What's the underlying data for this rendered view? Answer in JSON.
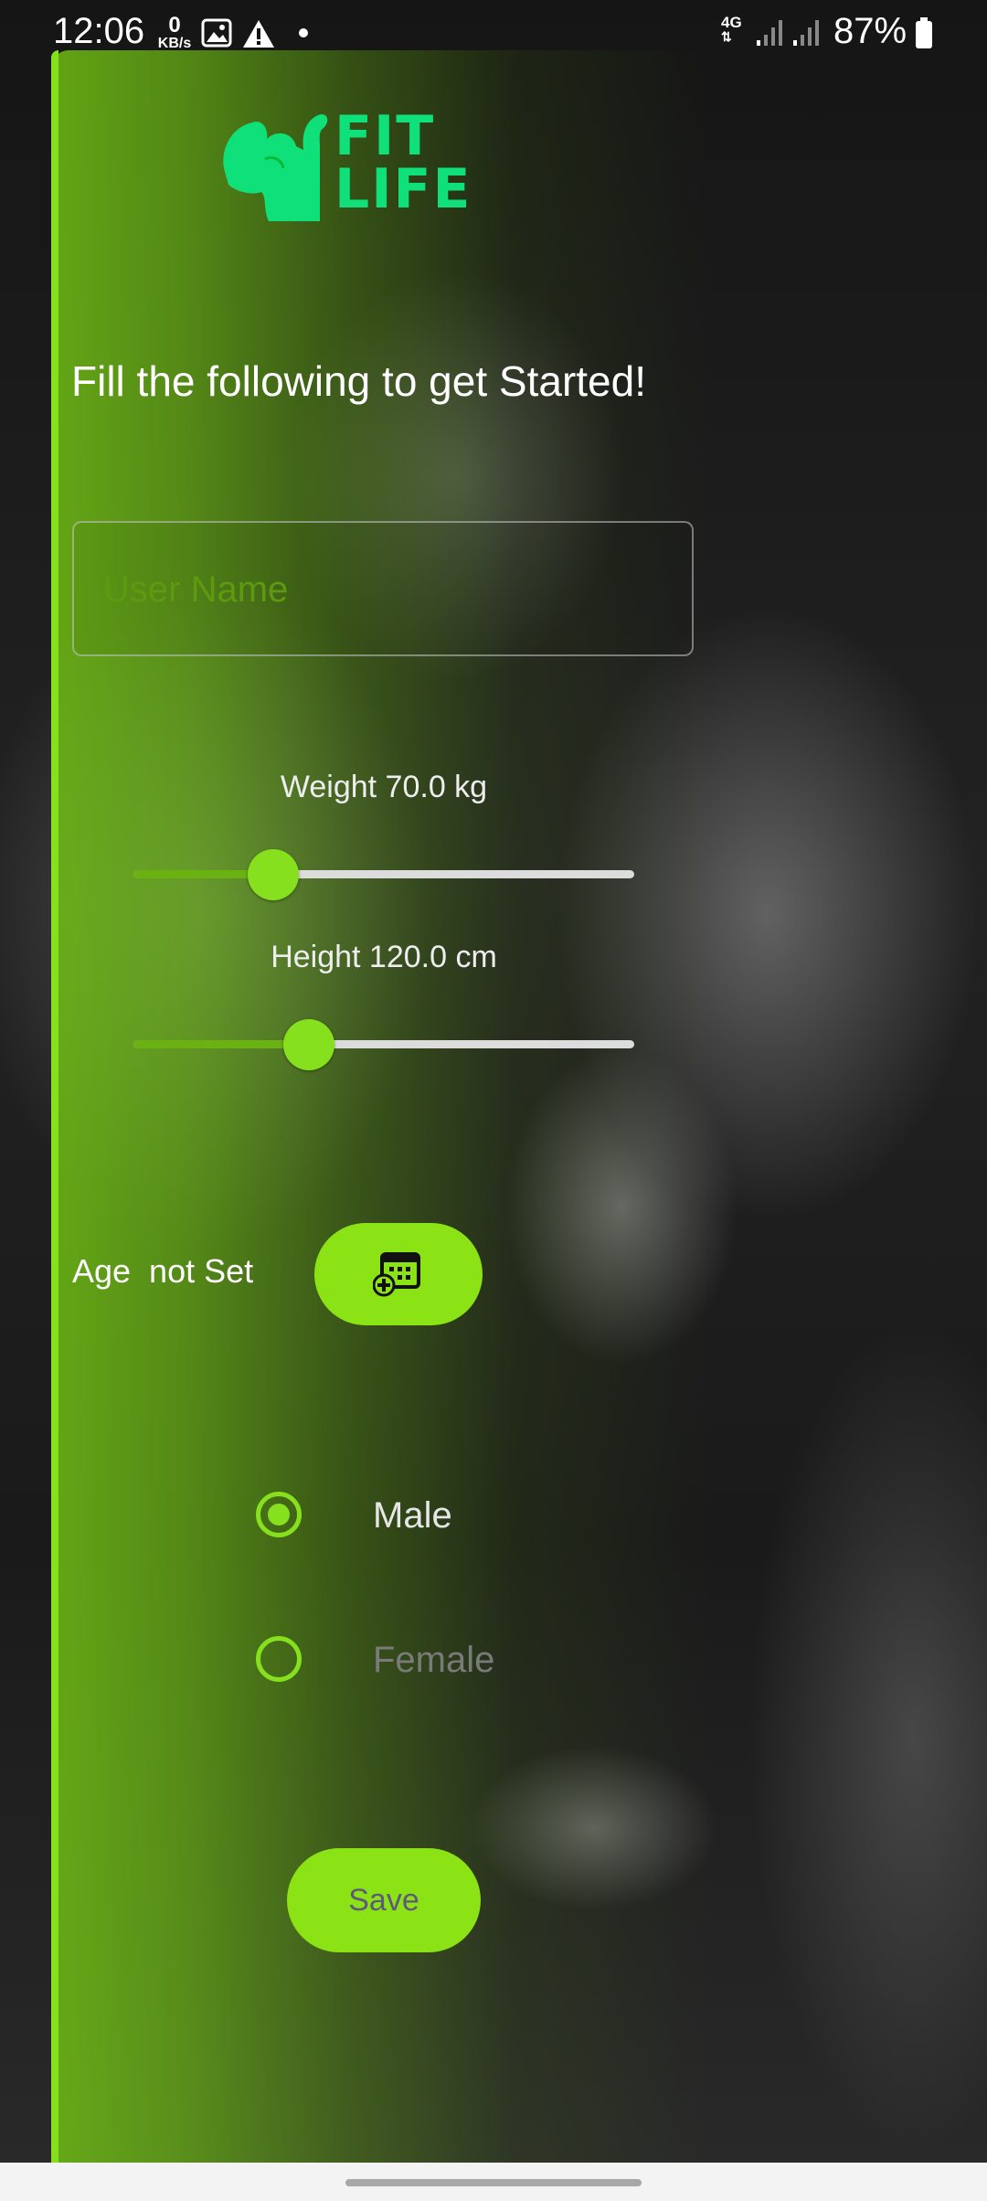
{
  "status_bar": {
    "time": "12:06",
    "net_speed_value": "0",
    "net_speed_unit": "KB/s",
    "network_type": "4G",
    "battery": "87%"
  },
  "logo": {
    "line1": "FIT",
    "line2": "LIFE"
  },
  "headline": "Fill the following to get Started!",
  "form": {
    "username_placeholder": "User Name",
    "username_value": "",
    "weight_label": "Weight 70.0 kg",
    "weight_fraction": 0.28,
    "height_label": "Height 120.0 cm",
    "height_fraction": 0.35,
    "age_label": "Age  not Set",
    "gender_options": [
      {
        "label": "Male",
        "selected": true,
        "color": "#e6e6e6"
      },
      {
        "label": "Female",
        "selected": false,
        "color": "#7a7a7a"
      }
    ],
    "save_label": "Save"
  },
  "colors": {
    "accent": "#86e01e",
    "logo_green": "#0fe07a",
    "button_text": "#5e5a7a"
  },
  "icons": [
    "image-icon",
    "warning-icon",
    "signal-icon",
    "battery-icon",
    "flexing-arm-icon",
    "calendar-add-icon"
  ]
}
